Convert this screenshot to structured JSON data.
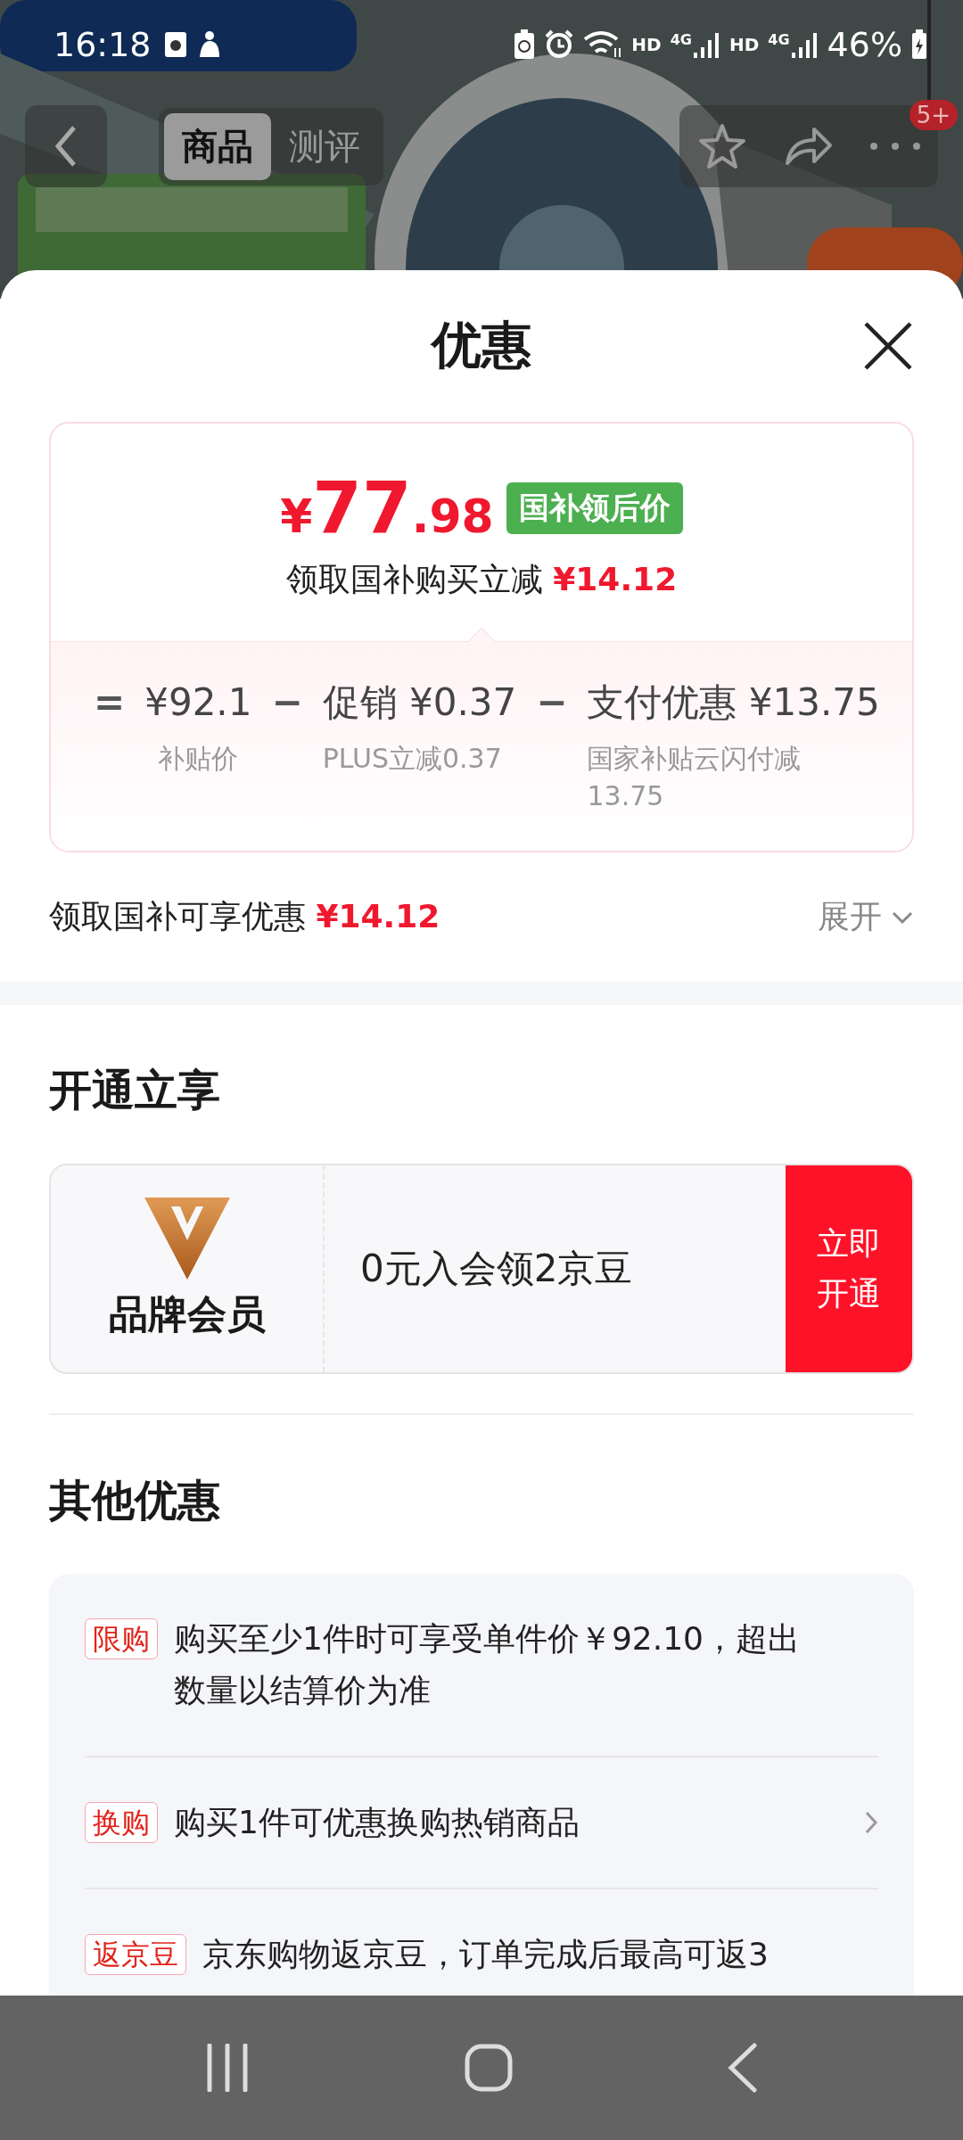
{
  "status_bar": {
    "time": "16:18",
    "network": [
      {
        "hd": "HD",
        "type": "4G"
      },
      {
        "hd": "HD",
        "type": "4G"
      }
    ],
    "battery": "46%"
  },
  "top_nav": {
    "tabs": [
      {
        "label": "商品",
        "selected": true
      },
      {
        "label": "测评",
        "selected": false
      }
    ],
    "badge": "5+"
  },
  "sheet": {
    "title": "优惠",
    "price_card": {
      "price": "¥77.98",
      "tag": "国补领后价",
      "subtitle": "领取国补购买立减",
      "subtitle_amount": "¥14.12",
      "breakdown": [
        {
          "operator": "=",
          "value": "¥92.1",
          "note": "补贴价"
        },
        {
          "operator": "−",
          "label": "促销",
          "value": "¥0.37",
          "note": "PLUS立减0.37"
        },
        {
          "operator": "−",
          "label": "支付优惠",
          "value": "¥13.75",
          "note": "国家补贴云闪付减13.75"
        }
      ]
    },
    "summary": {
      "label": "领取国补可享优惠",
      "amount": "¥14.12",
      "expand": "展开"
    },
    "membership": {
      "title": "开通立享",
      "name": "品牌会员",
      "offer": "0元入会领2京豆",
      "button": "立即开通"
    },
    "other": {
      "title": "其他优惠",
      "items": [
        {
          "tag": "限购",
          "text": "购买至少1件时可享受单件价￥92.10，超出数量以结算价为准",
          "chevron": false
        },
        {
          "tag": "换购",
          "text": "购买1件可优惠换购热销商品",
          "chevron": true
        },
        {
          "tag": "返京豆",
          "text": "京东购物返京豆，订单完成后最高可返3",
          "chevron": false
        }
      ]
    }
  }
}
